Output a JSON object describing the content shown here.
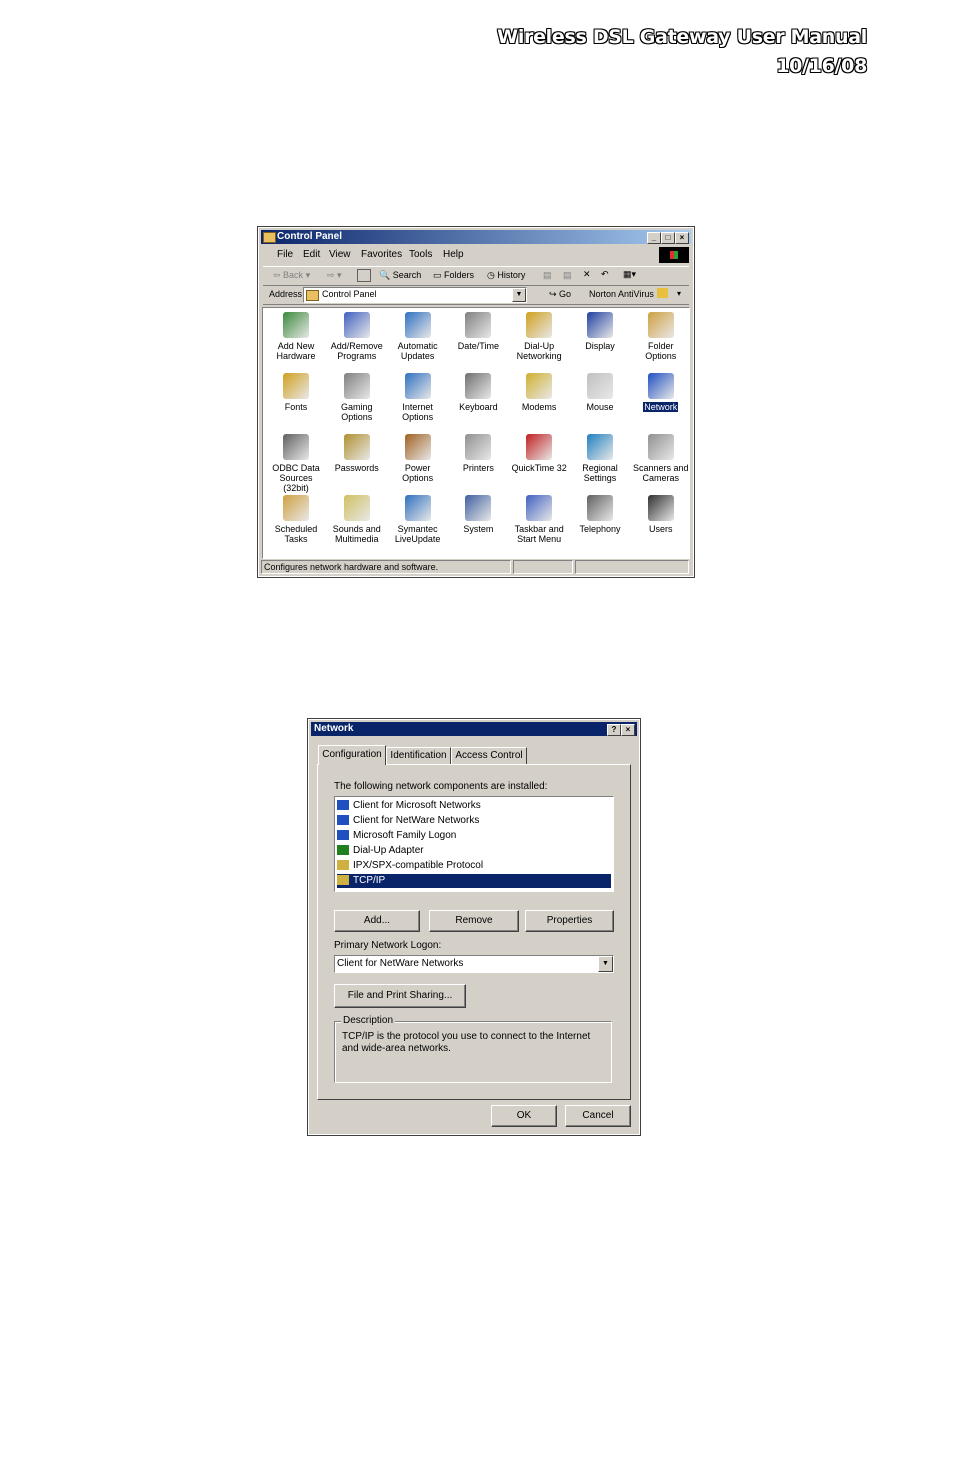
{
  "header": {
    "title": "Wireless DSL Gateway User Manual",
    "date": "10/16/08"
  },
  "control_panel": {
    "title": "Control Panel",
    "menu": [
      "File",
      "Edit",
      "View",
      "Favorites",
      "Tools",
      "Help"
    ],
    "toolbar": {
      "back": "Back",
      "search": "Search",
      "folders": "Folders",
      "history": "History"
    },
    "address_label": "Address",
    "address_value": "Control Panel",
    "go": "Go",
    "norton": "Norton AntiVirus",
    "icons": [
      [
        "Add New",
        "Hardware"
      ],
      [
        "Add/Remove",
        "Programs"
      ],
      [
        "Automatic",
        "Updates"
      ],
      [
        "Date/Time",
        ""
      ],
      [
        "Dial-Up",
        "Networking"
      ],
      [
        "Display",
        ""
      ],
      [
        "Folder Options",
        ""
      ],
      [
        "Fonts",
        ""
      ],
      [
        "Gaming",
        "Options"
      ],
      [
        "Internet",
        "Options"
      ],
      [
        "Keyboard",
        ""
      ],
      [
        "Modems",
        ""
      ],
      [
        "Mouse",
        ""
      ],
      [
        "Network",
        ""
      ],
      [
        "ODBC Data",
        "Sources (32bit)"
      ],
      [
        "Passwords",
        ""
      ],
      [
        "Power Options",
        ""
      ],
      [
        "Printers",
        ""
      ],
      [
        "QuickTime 32",
        ""
      ],
      [
        "Regional",
        "Settings"
      ],
      [
        "Scanners and",
        "Cameras"
      ],
      [
        "Scheduled",
        "Tasks"
      ],
      [
        "Sounds and",
        "Multimedia"
      ],
      [
        "Symantec",
        "LiveUpdate"
      ],
      [
        "System",
        ""
      ],
      [
        "Taskbar and",
        "Start Menu"
      ],
      [
        "Telephony",
        ""
      ],
      [
        "Users",
        ""
      ]
    ],
    "selected_icon": "Network",
    "status": "Configures network hardware and software."
  },
  "network_dialog": {
    "title": "Network",
    "tabs": [
      "Configuration",
      "Identification",
      "Access Control"
    ],
    "components_label": "The following network components are installed:",
    "components": [
      "Client for Microsoft Networks",
      "Client for NetWare Networks",
      "Microsoft Family Logon",
      "Dial-Up Adapter",
      "IPX/SPX-compatible Protocol",
      "TCP/IP"
    ],
    "selected_component": "TCP/IP",
    "add": "Add...",
    "remove": "Remove",
    "properties": "Properties",
    "primary_logon_label": "Primary Network Logon:",
    "primary_logon_value": "Client for NetWare Networks",
    "file_print": "File and Print Sharing...",
    "description_label": "Description",
    "description": "TCP/IP is the protocol you use to connect to the Internet and wide-area networks.",
    "ok": "OK",
    "cancel": "Cancel"
  }
}
